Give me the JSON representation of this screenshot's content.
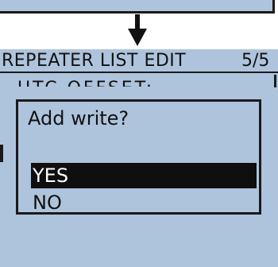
{
  "screen": {
    "title": "REPEATER LIST EDIT",
    "page_indicator": "5/5",
    "partial_item": "UTC OFFSET:"
  },
  "dialog": {
    "question": "Add write?",
    "options": [
      {
        "label": "YES",
        "selected": true
      },
      {
        "label": "NO",
        "selected": false
      }
    ]
  },
  "colors": {
    "lcd_background": "#aec4dc",
    "foreground": "#111111",
    "selection_background": "#0f0f0f",
    "selection_text": "#ffffff"
  },
  "icons": [
    "down-arrow-icon"
  ]
}
